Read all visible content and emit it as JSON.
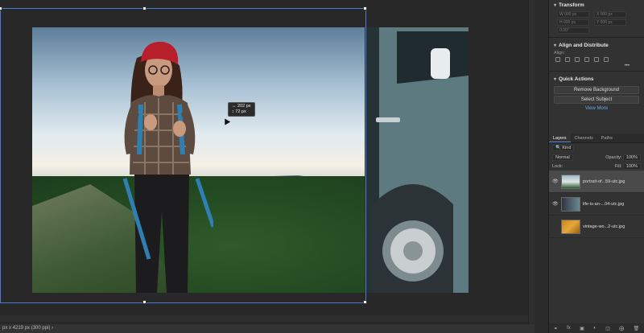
{
  "canvas": {
    "tooltip_w": "↔ 202 px",
    "tooltip_h": "↕ 72 px",
    "status": "px x 4219 px (300 ppi)  ›"
  },
  "properties": {
    "transform_title": "Transform",
    "transform_fields": [
      "W 000 px",
      "H 000 px",
      "X 000 px",
      "Y 000 px",
      "0.00°"
    ],
    "align_title": "Align and Distribute",
    "align_label": "Align:",
    "more_label": "•••",
    "quick_actions_title": "Quick Actions",
    "remove_bg_label": "Remove Background",
    "select_subject_label": "Select Subject",
    "view_more_label": "View More"
  },
  "layers_panel": {
    "tabs": [
      "Layers",
      "Channels",
      "Paths"
    ],
    "kind_placeholder": "Kind",
    "blend_mode": "Normal",
    "opacity_label": "Opacity:",
    "opacity_value": "100%",
    "lock_label": "Lock:",
    "fill_label": "Fill:",
    "fill_value": "100%",
    "layers": [
      {
        "name": "portrait-of...59-utc.jpg",
        "visible": true,
        "selected": true
      },
      {
        "name": "life-is-an-...04-utc.jpg",
        "visible": true,
        "selected": false
      },
      {
        "name": "vintage-wo...2-utc.jpg",
        "visible": false,
        "selected": false
      }
    ],
    "bottom_icons": [
      "link-icon",
      "fx-icon",
      "mask-icon",
      "adjustment-icon",
      "folder-icon",
      "new-layer-icon",
      "trash-icon"
    ]
  },
  "colors": {
    "accent": "#5a8de0",
    "selection": "#4b7bd8",
    "panel": "#323232",
    "canvas": "#282828"
  }
}
